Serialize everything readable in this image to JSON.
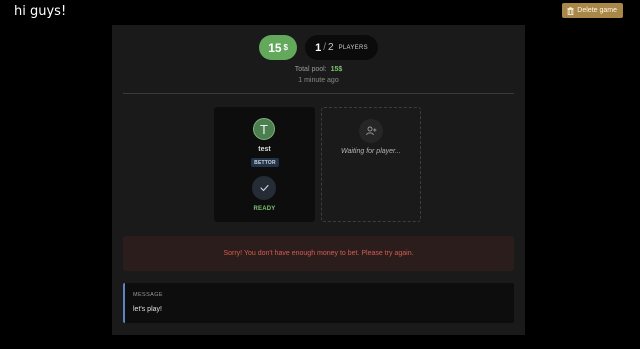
{
  "page": {
    "title": "hi guys!"
  },
  "toolbar": {
    "delete_label": "Delete game",
    "delete_icon": "trash-icon"
  },
  "game": {
    "price_value": "15",
    "price_unit": "$",
    "players_current": "1",
    "players_separator": "/",
    "players_max": "2",
    "players_label": "PLAYERS",
    "pool_label": "Total pool:",
    "pool_amount": "15$",
    "created": "1 minute ago"
  },
  "players": [
    {
      "avatar_initial": "T",
      "name": "test",
      "role": "BETTOR",
      "status": "READY",
      "status_icon": "check-icon"
    }
  ],
  "waiting_slot": {
    "icon": "add-user-icon",
    "text": "Waiting for player..."
  },
  "alert": {
    "text": "Sorry! You don't have enough money to bet. Please try again."
  },
  "message": {
    "label": "MESSAGE",
    "text": "let's play!"
  },
  "colors": {
    "price_chip": "#63a95c",
    "ready": "#7cc36e",
    "error_text": "#d35d4e",
    "delete_button": "#a88748",
    "message_accent": "#5e82c2"
  }
}
